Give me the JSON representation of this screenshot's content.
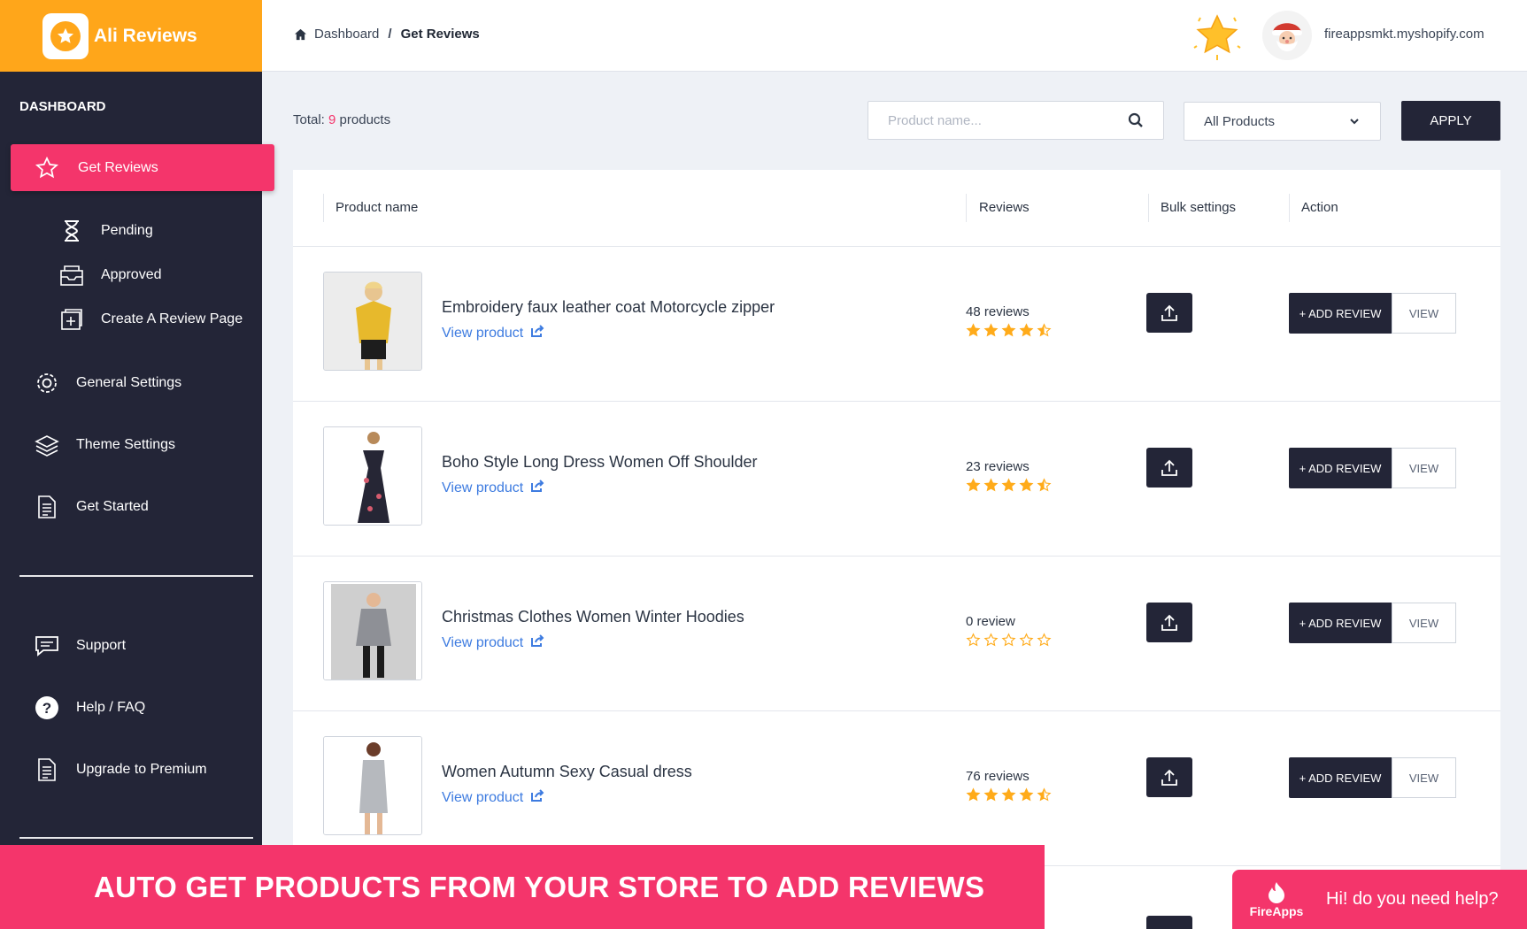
{
  "app": {
    "name": "Ali Reviews"
  },
  "sidebar": {
    "heading": "DASHBOARD",
    "active": {
      "label": "Get Reviews",
      "icon": "star-outline-icon"
    },
    "sub_items": [
      {
        "label": "Pending",
        "icon": "hourglass-icon"
      },
      {
        "label": "Approved",
        "icon": "inbox-icon"
      },
      {
        "label": "Create A Review Page",
        "icon": "add-page-icon"
      }
    ],
    "items": [
      {
        "label": "General Settings",
        "icon": "gear-icon"
      },
      {
        "label": "Theme Settings",
        "icon": "layers-icon"
      },
      {
        "label": "Get Started",
        "icon": "document-icon"
      }
    ],
    "bottom_items": [
      {
        "label": "Support",
        "icon": "chat-icon"
      },
      {
        "label": "Help / FAQ",
        "icon": "question-icon"
      },
      {
        "label": "Upgrade to Premium",
        "icon": "document-icon"
      }
    ]
  },
  "breadcrumb": {
    "home": "Dashboard",
    "separator": "/",
    "current": "Get Reviews"
  },
  "topbar": {
    "shop": "fireappsmkt.myshopify.com"
  },
  "toolbar": {
    "total_prefix": "Total: ",
    "total_count": "9",
    "total_suffix": " products",
    "search_placeholder": "Product name...",
    "filter_value": "All Products",
    "apply_label": "APPLY"
  },
  "table": {
    "headers": [
      "Product name",
      "Reviews",
      "Bulk settings",
      "Action"
    ],
    "view_product_label": "View product",
    "add_review_label": "+ ADD REVIEW",
    "view_label": "VIEW",
    "rows": [
      {
        "name": "Embroidery faux leather coat Motorcycle zipper",
        "reviews": "48 reviews",
        "rating": 4.5,
        "thumb_color": "#e9c13a"
      },
      {
        "name": "Boho Style Long Dress Women Off Shoulder",
        "reviews": "23 reviews",
        "rating": 4.5,
        "thumb_color": "#2a2a3a"
      },
      {
        "name": "Christmas Clothes Women Winter Hoodies",
        "reviews": "0 review",
        "rating": 0,
        "thumb_color": "#9a9ea4"
      },
      {
        "name": "Women Autumn Sexy Casual dress",
        "reviews": "76 reviews",
        "rating": 4.5,
        "thumb_color": "#b8bcc2"
      }
    ]
  },
  "banner": {
    "text": "AUTO GET PRODUCTS FROM YOUR STORE TO ADD REVIEWS"
  },
  "help_widget": {
    "brand": "FireApps",
    "text": "Hi! do you need help?"
  },
  "colors": {
    "accent": "#f4356b",
    "brand": "#ffa61a",
    "dark": "#232537",
    "link": "#3d7be0",
    "star": "#ffab1a"
  }
}
